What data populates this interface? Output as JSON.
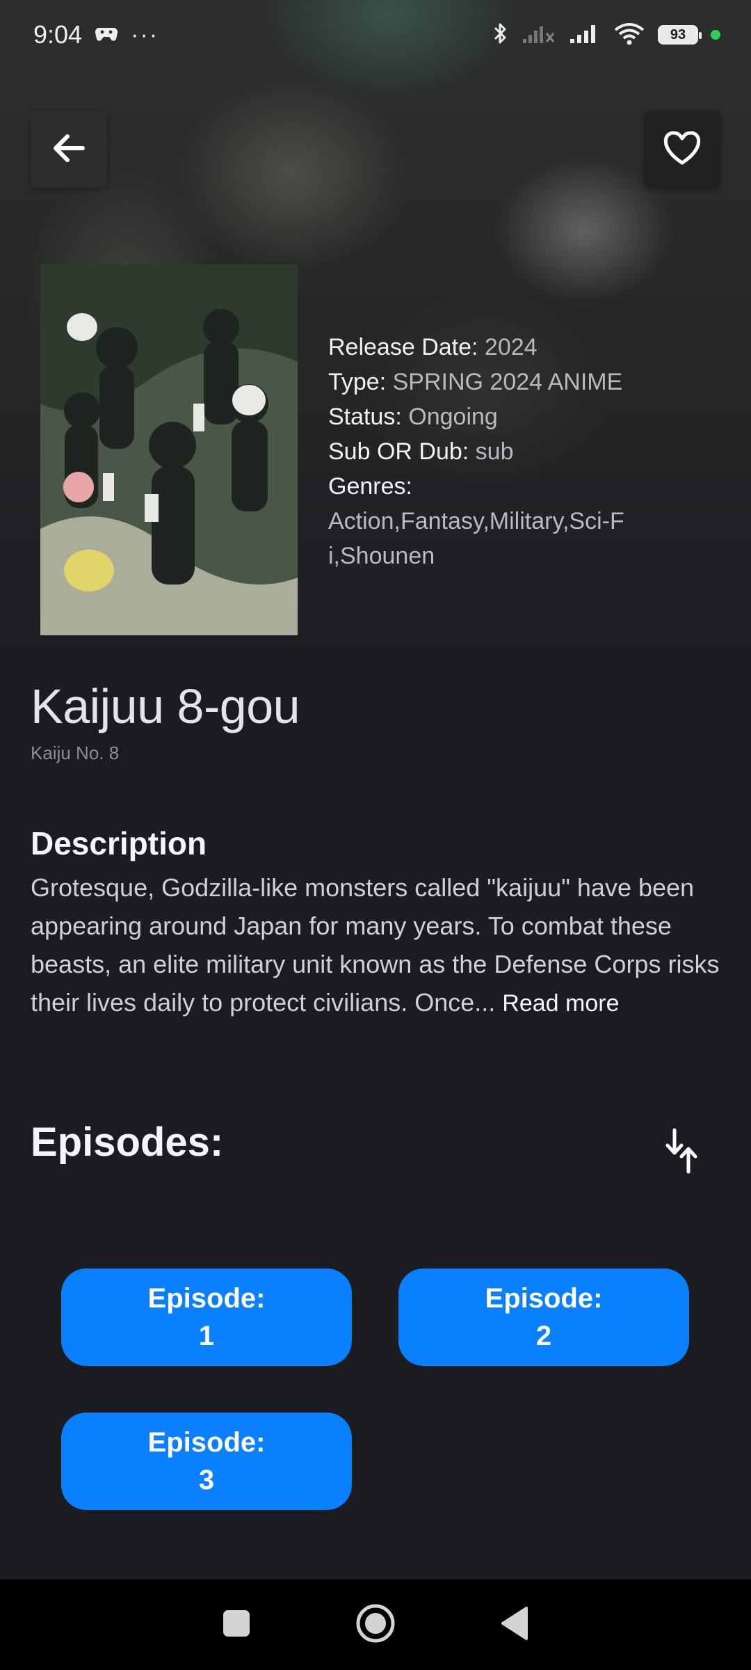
{
  "status_bar": {
    "time": "9:04",
    "more": "···",
    "battery": "93"
  },
  "header": {
    "back_icon": "arrow-left-icon",
    "favorite_icon": "heart-outline-icon"
  },
  "anime": {
    "title": "Kaijuu 8-gou",
    "english_title": "Kaiju No. 8",
    "info": [
      {
        "key": "Release Date:",
        "value": "2024"
      },
      {
        "key": "Type:",
        "value": "SPRING 2024 ANIME"
      },
      {
        "key": "Status:",
        "value": "Ongoing"
      },
      {
        "key": "Sub OR Dub:",
        "value": "sub"
      },
      {
        "key": "Genres:",
        "value": "Action,Fantasy,Military,Sci-Fi,Shounen"
      }
    ]
  },
  "description": {
    "heading": "Description",
    "text": "Grotesque, Godzilla-like monsters called \"kaijuu\" have been appearing around Japan for many years. To combat these beasts, an elite military unit known as the Defense Corps risks their lives daily to protect civilians. Once...",
    "read_more": "Read more"
  },
  "episodes": {
    "heading": "Episodes:",
    "sort_icon": "sort-arrows-icon",
    "items": [
      {
        "label": "Episode:",
        "number": "1"
      },
      {
        "label": "Episode:",
        "number": "2"
      },
      {
        "label": "Episode:",
        "number": "3"
      }
    ]
  },
  "colors": {
    "background": "#1b1c21",
    "episode_button": "#0a80ff",
    "status_dot": "#2fd15b"
  }
}
